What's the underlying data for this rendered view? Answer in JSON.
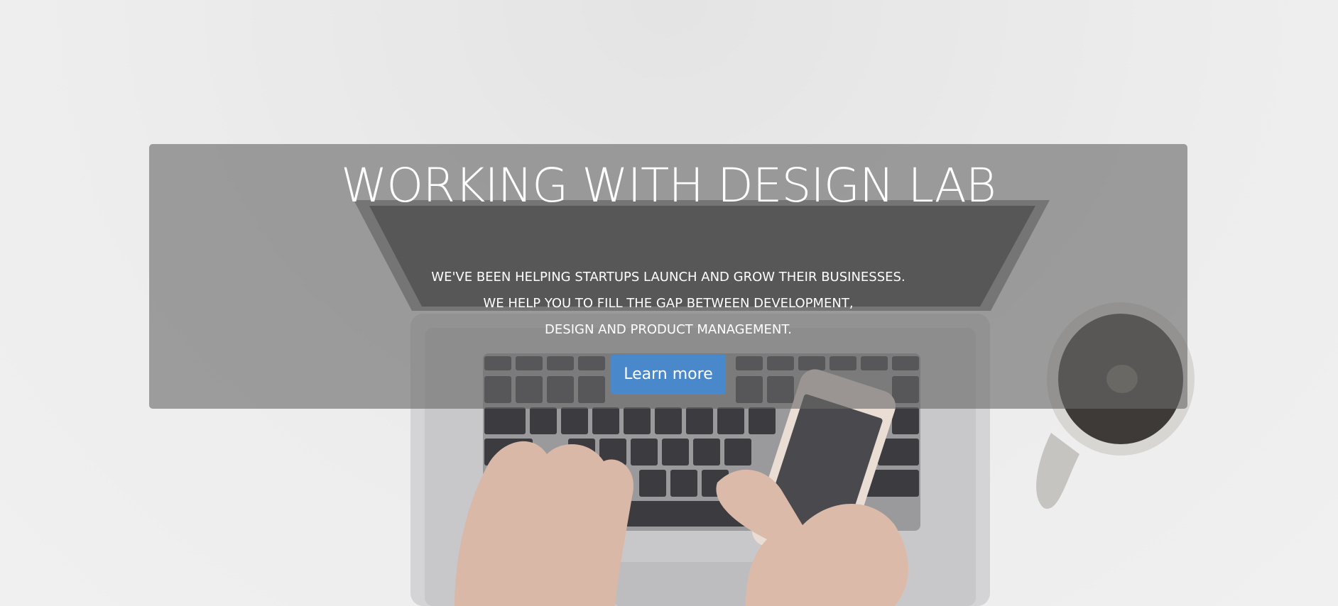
{
  "hero": {
    "title": "WORKING WITH DESIGN LAB",
    "lines": [
      "WE'VE BEEN HELPING STARTUPS LAUNCH AND GROW THEIR BUSINESSES.",
      "WE HELP YOU TO FILL THE GAP BETWEEN DEVELOPMENT,",
      "DESIGN AND PRODUCT MANAGEMENT."
    ],
    "cta_label": "Learn more"
  },
  "colors": {
    "button": "#4a88cc",
    "overlay": "#696969",
    "text": "#ffffff"
  }
}
